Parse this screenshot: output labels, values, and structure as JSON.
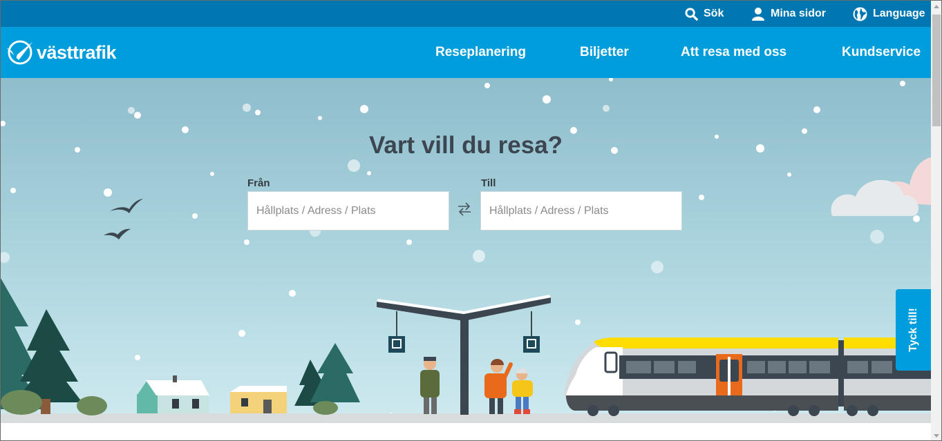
{
  "utility": {
    "search": "Sök",
    "my_pages": "Mina sidor",
    "language": "Language"
  },
  "brand": {
    "name": "västtrafik"
  },
  "nav": [
    {
      "label": "Reseplanering"
    },
    {
      "label": "Biljetter"
    },
    {
      "label": "Att resa med oss"
    },
    {
      "label": "Kundservice"
    }
  ],
  "hero": {
    "title": "Vart vill du resa?",
    "from_label": "Från",
    "to_label": "Till",
    "from_placeholder": "Hållplats / Adress / Plats",
    "to_placeholder": "Hållplats / Adress / Plats"
  },
  "feedback": {
    "label": "Tyck till!"
  },
  "colors": {
    "topbar": "#0077b0",
    "navbar": "#009ddc",
    "title_text": "#3b4650",
    "train_stripe": "#ffdd00",
    "train_door": "#e86a1a"
  }
}
